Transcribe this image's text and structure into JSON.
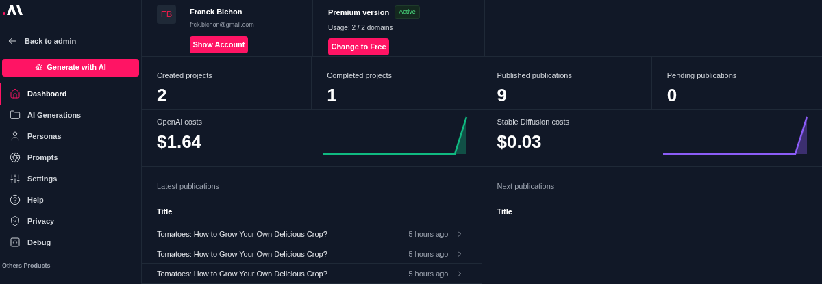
{
  "sidebar": {
    "back_link": "Back to admin",
    "generate_button": "Generate with AI",
    "items": [
      {
        "label": "Dashboard",
        "selected": true
      },
      {
        "label": "AI Generations",
        "selected": false
      },
      {
        "label": "Personas",
        "selected": false
      },
      {
        "label": "Prompts",
        "selected": false
      },
      {
        "label": "Settings",
        "selected": false
      },
      {
        "label": "Help",
        "selected": false
      },
      {
        "label": "Privacy",
        "selected": false
      },
      {
        "label": "Debug",
        "selected": false
      }
    ],
    "section_title": "Others Products"
  },
  "account": {
    "initials": "FB",
    "name": "Franck Bichon",
    "email": "frck.bichon@gmail.com",
    "button": "Show Account"
  },
  "plan": {
    "name": "Premium version",
    "badge": "Active",
    "usage": "Usage: 2 / 2 domains",
    "button": "Change to Free"
  },
  "stats": [
    {
      "label": "Created projects",
      "value": "2"
    },
    {
      "label": "Completed projects",
      "value": "1"
    },
    {
      "label": "Published publications",
      "value": "9"
    },
    {
      "label": "Pending publications",
      "value": "0"
    }
  ],
  "costs": [
    {
      "label": "OpenAI costs",
      "value": "$1.64",
      "color": "#10b981"
    },
    {
      "label": "Stable Diffusion costs",
      "value": "$0.03",
      "color": "#8b5cf6"
    }
  ],
  "latest_publications": {
    "title": "Latest publications",
    "column": "Title",
    "rows": [
      {
        "title": "Tomatoes: How to Grow Your Own Delicious Crop?",
        "time": "5 hours ago"
      },
      {
        "title": "Tomatoes: How to Grow Your Own Delicious Crop?",
        "time": "5 hours ago"
      },
      {
        "title": "Tomatoes: How to Grow Your Own Delicious Crop?",
        "time": "5 hours ago"
      }
    ]
  },
  "next_publications": {
    "title": "Next publications",
    "column": "Title"
  }
}
